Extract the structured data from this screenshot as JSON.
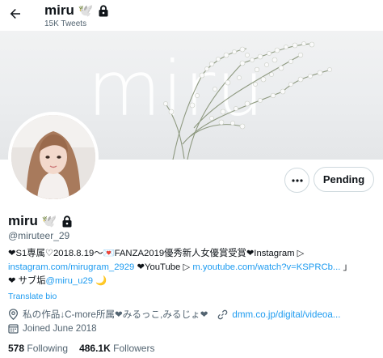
{
  "header": {
    "name": "miru",
    "name_emoji": "🕊️",
    "tweet_count": "15K Tweets"
  },
  "banner": {
    "watermark_text": "miru"
  },
  "actions": {
    "more_icon": "more-horizontal-icon",
    "pending_label": "Pending"
  },
  "profile": {
    "display_name": "miru",
    "name_emoji": "🕊️",
    "handle": "@miruteer_29",
    "bio": {
      "line1_prefix": "❤S1専属♡2018.8.19～💌FANZA2019優秀新人女優賞受賞❤Instagram ▷",
      "line2_link1": "instagram.com/mirugram_2929",
      "line2_middle": " ❤YouTube ▷ ",
      "line2_link2": "m.youtube.com/watch?v=KSPRCb...",
      "line2_suffix": " 」",
      "line3_prefix": "❤ サブ垢",
      "line3_link": "@miru_u29",
      "line3_suffix": " 🌙"
    },
    "translate_label": "Translate bio",
    "location": "私の作品↓C-more所属❤みるっこ,みるじょ❤",
    "website": "dmm.co.jp/digital/videoa...",
    "joined": "Joined June 2018",
    "following_count": "578",
    "following_label": "Following",
    "followers_count": "486.1K",
    "followers_label": "Followers"
  },
  "colors": {
    "accent": "#1d9bf0",
    "text": "#0f1419",
    "secondary_text": "#536471",
    "border": "#cfd9de"
  }
}
